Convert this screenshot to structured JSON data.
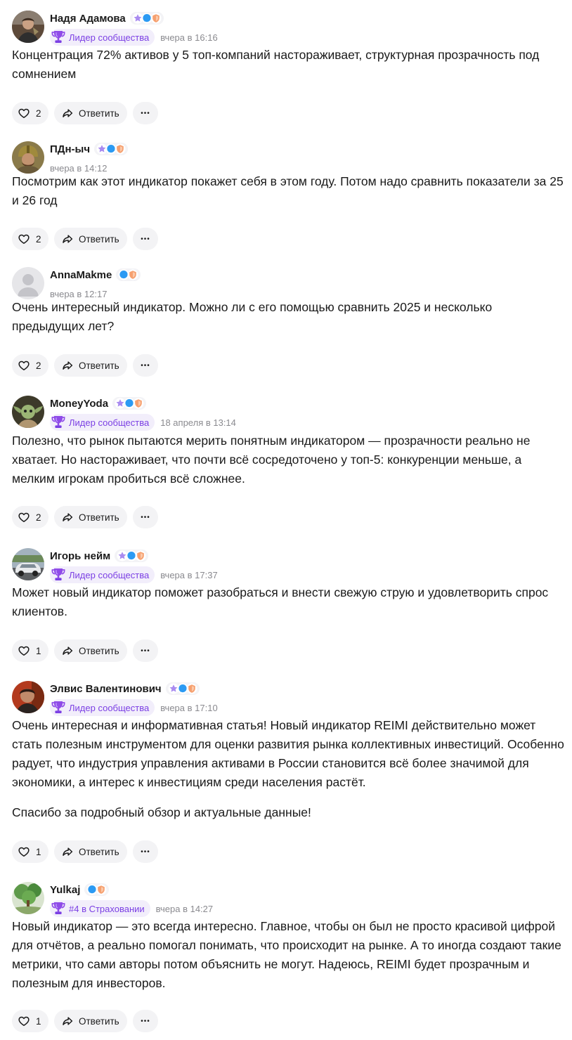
{
  "ui": {
    "reply_label": "Ответить",
    "more_label": "•••"
  },
  "colors": {
    "accent": "#7b3fe4",
    "status_bg": "#f2eefb",
    "button_bg": "#f3f3f5",
    "time": "#8a8a8f"
  },
  "comments": [
    {
      "author": "Надя Адамова",
      "badges": [
        "star-badge",
        "chat-badge",
        "shield-badge"
      ],
      "status": "Лидер сообщества",
      "time": "вчера в 16:16",
      "paragraphs": [
        "Концентрация 72% активов у 5 топ-компаний настораживает, структурная прозрачность под сомнением"
      ],
      "likes": "2",
      "avatar": "portrait-photo"
    },
    {
      "author": "ПДн-ыч",
      "badges": [
        "star-badge",
        "chat-badge",
        "shield-badge"
      ],
      "status": "",
      "time": "вчера в 14:12",
      "paragraphs": [
        "Посмотрим как этот индикатор покажет себя в этом году. Потом надо сравнить показатели за 25 и 26 год"
      ],
      "likes": "2",
      "avatar": "warrior-photo"
    },
    {
      "author": "AnnaMakme",
      "badges": [
        "chat-badge",
        "shield-badge"
      ],
      "status": "",
      "time": "вчера в 12:17",
      "paragraphs": [
        "Очень интересный индикатор. Можно ли с его помощью сравнить 2025 и несколько предыдущих лет?"
      ],
      "likes": "2",
      "avatar": "default-avatar"
    },
    {
      "author": "MoneyYoda",
      "badges": [
        "star-badge",
        "chat-badge",
        "shield-badge"
      ],
      "status": "Лидер сообщества",
      "time": "18 апреля в 13:14",
      "paragraphs": [
        "Полезно, что рынок пытаются мерить понятным индикатором — прозрачности реально не хватает. Но настораживает, что почти всё сосредоточено у топ-5: конкуренции меньше, а мелким игрокам пробиться всё сложнее."
      ],
      "likes": "2",
      "avatar": "yoda-photo"
    },
    {
      "author": "Игорь нейм",
      "badges": [
        "star-badge",
        "chat-badge",
        "shield-badge"
      ],
      "status": "Лидер сообщества",
      "time": "вчера в 17:37",
      "paragraphs": [
        "Может новый индикатор поможет разобраться и внести свежую струю и удовлетворить спрос клиентов."
      ],
      "likes": "1",
      "avatar": "car-photo"
    },
    {
      "author": "Элвис Валентинович",
      "badges": [
        "star-badge",
        "chat-badge",
        "shield-badge"
      ],
      "status": "Лидер сообщества",
      "time": "вчера в 17:10",
      "paragraphs": [
        "Очень интересная и информативная статья! Новый индикатор REIMI действительно может стать полезным инструментом для оценки развития рынка коллективных инвестиций. Особенно радует, что индустрия управления активами в России становится всё более значимой для экономики, а интерес к инвестициям среди населения растёт.",
        "Спасибо за подробный обзор и актуальные данные!"
      ],
      "likes": "1",
      "avatar": "man-photo"
    },
    {
      "author": "Yulkaj",
      "badges": [
        "chat-badge",
        "shield-badge"
      ],
      "status": "#4 в Страховании",
      "time": "вчера в 14:27",
      "paragraphs": [
        "Новый индикатор — это всегда интересно. Главное, чтобы он был не просто красивой цифрой для отчётов, а реально помогал понимать, что происходит на рынке. А то иногда создают такие метрики, что сами авторы потом объяснить не могут. Надеюсь, REIMI будет прозрачным и полезным для инвесторов."
      ],
      "likes": "1",
      "avatar": "tree-photo"
    }
  ]
}
